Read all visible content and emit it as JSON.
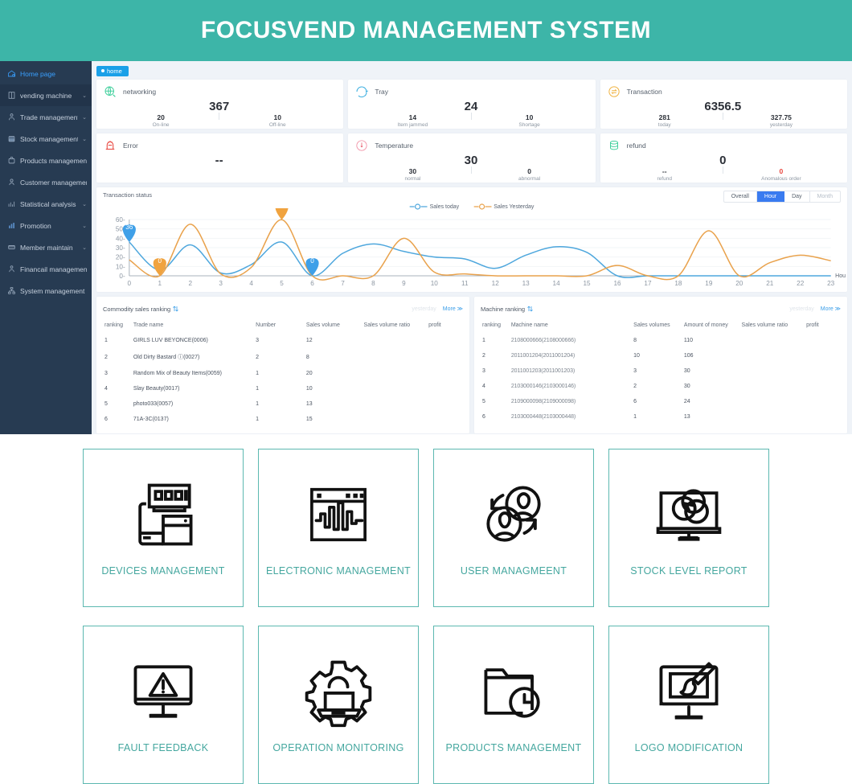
{
  "header": {
    "title": "FOCUSVEND MANAGEMENT SYSTEM",
    "bg": "#3db5a8"
  },
  "sidebar": {
    "items": [
      {
        "label": "Home page",
        "icon": "home-icon",
        "caret": "",
        "active": true
      },
      {
        "label": "vending machine",
        "icon": "machine-icon",
        "caret": "⌄"
      },
      {
        "label": "Trade management",
        "icon": "trade-icon",
        "caret": "⌄"
      },
      {
        "label": "Stock management",
        "icon": "stock-icon",
        "caret": "⌄"
      },
      {
        "label": "Products management",
        "icon": "products-icon",
        "caret": ""
      },
      {
        "label": "Customer management",
        "icon": "customer-icon",
        "caret": ""
      },
      {
        "label": "Statistical analysis",
        "icon": "stats-icon",
        "caret": "⌄"
      },
      {
        "label": "Promotion",
        "icon": "promotion-icon",
        "caret": "⌄"
      },
      {
        "label": "Member maintain",
        "icon": "member-icon",
        "caret": "⌄"
      },
      {
        "label": "Financail management",
        "icon": "finance-icon",
        "caret": ""
      },
      {
        "label": "System management",
        "icon": "system-icon",
        "caret": ""
      }
    ]
  },
  "tabs": {
    "home": "home"
  },
  "cards": [
    {
      "name": "networking",
      "icon": "globe-icon",
      "main": "367",
      "left": {
        "value": "20",
        "label": "On-line"
      },
      "right": {
        "value": "10",
        "label": "Off-line"
      }
    },
    {
      "name": "Tray",
      "icon": "tray-icon",
      "main": "24",
      "left": {
        "value": "14",
        "label": "Item jammed"
      },
      "right": {
        "value": "10",
        "label": "Shortage"
      }
    },
    {
      "name": "Transaction",
      "icon": "transaction-icon",
      "main": "6356.5",
      "left": {
        "value": "281",
        "label": "today"
      },
      "right": {
        "value": "327.75",
        "label": "yesterday"
      }
    },
    {
      "name": "Error",
      "icon": "alarm-icon",
      "main": "--",
      "left": {
        "value": "",
        "label": ""
      },
      "right": {
        "value": "",
        "label": ""
      }
    },
    {
      "name": "Temperature",
      "icon": "thermometer-icon",
      "main": "30",
      "left": {
        "value": "30",
        "label": "normal"
      },
      "right": {
        "value": "0",
        "label": "abnormal"
      }
    },
    {
      "name": "refund",
      "icon": "coins-icon",
      "main": "0",
      "left": {
        "value": "--",
        "label": "refund"
      },
      "right": {
        "value": "0",
        "label": "Anomalous order",
        "red": true
      }
    }
  ],
  "chart_panel": {
    "title": "Transaction status",
    "segments": [
      {
        "label": "Overall",
        "active": false
      },
      {
        "label": "Hour",
        "active": true
      },
      {
        "label": "Day",
        "active": false
      },
      {
        "label": "Month",
        "active": false,
        "disabled": true
      }
    ],
    "hour_axis_label": "Hou"
  },
  "chart_data": {
    "type": "line",
    "title": "Transaction status",
    "xlabel": "Hou",
    "ylabel": "",
    "ylim": [
      0,
      60
    ],
    "yticks": [
      0,
      10,
      20,
      30,
      40,
      50,
      60
    ],
    "x": [
      0,
      1,
      2,
      3,
      4,
      5,
      6,
      7,
      8,
      9,
      10,
      11,
      12,
      13,
      14,
      15,
      16,
      17,
      18,
      19,
      20,
      21,
      22,
      23
    ],
    "grid": true,
    "legend_position": "top-center",
    "series": [
      {
        "name": "Sales today",
        "color": "#4ea7dd",
        "values": [
          36,
          6,
          33,
          3,
          12,
          36,
          0,
          24,
          34,
          26,
          20,
          18,
          8,
          22,
          31,
          25,
          0,
          0,
          0,
          0,
          0,
          0,
          0,
          0
        ]
      },
      {
        "name": "Sales Yesterday",
        "color": "#e9a24c",
        "values": [
          17,
          0,
          55,
          2,
          9,
          59.75,
          0,
          0,
          0,
          40,
          4,
          2,
          0,
          0,
          0,
          0,
          11,
          0,
          0,
          48,
          0,
          14,
          22,
          16
        ]
      }
    ],
    "annotations": [
      {
        "x": 0,
        "value": "36",
        "series": "Sales today",
        "color": "#3fa0e8"
      },
      {
        "x": 1,
        "value": "0",
        "series": "Sales Yesterday",
        "color": "#f0a33f"
      },
      {
        "x": 5,
        "value": "59.75",
        "series": "Sales Yesterday",
        "color": "#f0a33f"
      },
      {
        "x": 6,
        "value": "0",
        "series": "Sales today",
        "color": "#3fa0e8"
      }
    ]
  },
  "commodity_table": {
    "title": "Commodity sales ranking",
    "ghost_label": "yesterday",
    "more_label": "More ≫",
    "columns": [
      "ranking",
      "Trade name",
      "Number",
      "Sales volume",
      "Sales volume ratio",
      "profit"
    ],
    "rows": [
      [
        "1",
        "GIRLS LUV BEYONCE(0006)",
        "3",
        "12",
        "",
        ""
      ],
      [
        "2",
        "Old Dirty Bastard ⓘ(0027)",
        "2",
        "8",
        "",
        ""
      ],
      [
        "3",
        "Random Mix of Beauty Items(0059)",
        "1",
        "20",
        "",
        ""
      ],
      [
        "4",
        "Slay Beauty(0017)",
        "1",
        "10",
        "",
        ""
      ],
      [
        "5",
        "photo033(0057)",
        "1",
        "13",
        "",
        ""
      ],
      [
        "6",
        "71A-3C(0137)",
        "1",
        "15",
        "",
        ""
      ]
    ]
  },
  "machine_table": {
    "title": "Machine ranking",
    "ghost_label": "yesterday",
    "more_label": "More ≫",
    "columns": [
      "ranking",
      "Machine name",
      "Sales volumes",
      "Amount of money",
      "Sales volume ratio",
      "profit"
    ],
    "rows": [
      [
        "1",
        "2108000666(2108000666)",
        "8",
        "110",
        "",
        ""
      ],
      [
        "2",
        "2011001204(2011001204)",
        "10",
        "106",
        "",
        ""
      ],
      [
        "3",
        "2011001203(2011001203)",
        "3",
        "30",
        "",
        ""
      ],
      [
        "4",
        "2103000146(2103000146)",
        "2",
        "30",
        "",
        ""
      ],
      [
        "5",
        "2109000098(2109000098)",
        "6",
        "24",
        "",
        ""
      ],
      [
        "6",
        "2103000448(2103000448)",
        "1",
        "13",
        "",
        ""
      ]
    ]
  },
  "icon_cards": {
    "accent": "#45a79f",
    "border": "#5cb8b0",
    "rows": [
      [
        {
          "label": "DEVICES MANAGEMENT",
          "icon": "devices-icon"
        },
        {
          "label": "ELECTRONIC MANAGEMENT",
          "icon": "waveform-window-icon"
        },
        {
          "label": "USER MANAGMEENT",
          "icon": "users-sync-icon"
        },
        {
          "label": "STOCK LEVEL REPORT",
          "icon": "monitor-chart-icon"
        }
      ],
      [
        {
          "label": "FAULT FEEDBACK",
          "icon": "monitor-warning-icon"
        },
        {
          "label": "OPERATION MONITORING",
          "icon": "gear-laptop-icon"
        },
        {
          "label": "PRODUCTS MANAGEMENT",
          "icon": "folder-clock-icon"
        },
        {
          "label": "LOGO MODIFICATION",
          "icon": "monitor-brush-icon"
        }
      ]
    ]
  }
}
